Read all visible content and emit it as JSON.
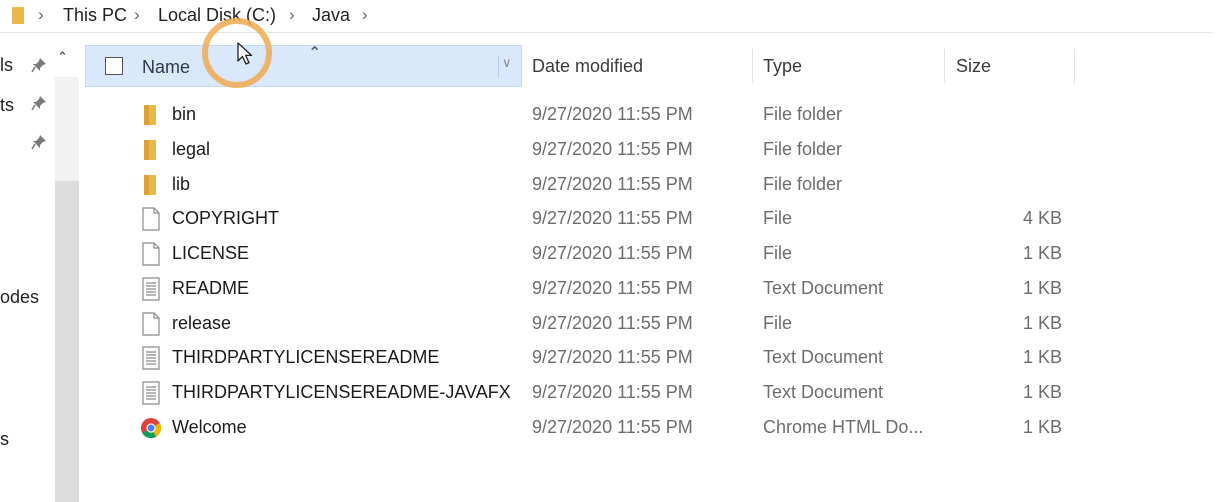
{
  "address": {
    "crumbs": [
      "This PC",
      "Local Disk (C:)",
      "Java"
    ]
  },
  "nav": {
    "items": [
      "ls",
      "ts",
      "",
      "odes",
      "s"
    ]
  },
  "columns": {
    "name": "Name",
    "date": "Date modified",
    "type": "Type",
    "size": "Size"
  },
  "files": [
    {
      "name": "bin",
      "date": "9/27/2020 11:55 PM",
      "type": "File folder",
      "size": "",
      "icon": "folder-icon"
    },
    {
      "name": "legal",
      "date": "9/27/2020 11:55 PM",
      "type": "File folder",
      "size": "",
      "icon": "folder-icon"
    },
    {
      "name": "lib",
      "date": "9/27/2020 11:55 PM",
      "type": "File folder",
      "size": "",
      "icon": "folder-icon"
    },
    {
      "name": "COPYRIGHT",
      "date": "9/27/2020 11:55 PM",
      "type": "File",
      "size": "4 KB",
      "icon": "file-icon"
    },
    {
      "name": "LICENSE",
      "date": "9/27/2020 11:55 PM",
      "type": "File",
      "size": "1 KB",
      "icon": "file-icon"
    },
    {
      "name": "README",
      "date": "9/27/2020 11:55 PM",
      "type": "Text Document",
      "size": "1 KB",
      "icon": "text-document-icon"
    },
    {
      "name": "release",
      "date": "9/27/2020 11:55 PM",
      "type": "File",
      "size": "1 KB",
      "icon": "file-icon"
    },
    {
      "name": "THIRDPARTYLICENSEREADME",
      "date": "9/27/2020 11:55 PM",
      "type": "Text Document",
      "size": "1 KB",
      "icon": "text-document-icon"
    },
    {
      "name": "THIRDPARTYLICENSEREADME-JAVAFX",
      "date": "9/27/2020 11:55 PM",
      "type": "Text Document",
      "size": "1 KB",
      "icon": "text-document-icon"
    },
    {
      "name": "Welcome",
      "date": "9/27/2020 11:55 PM",
      "type": "Chrome HTML Do...",
      "size": "1 KB",
      "icon": "chrome-icon"
    }
  ],
  "colors": {
    "folder": "#e9b84a",
    "header_selected": "#d9e8fb",
    "cursor_highlight": "#efaa50"
  }
}
